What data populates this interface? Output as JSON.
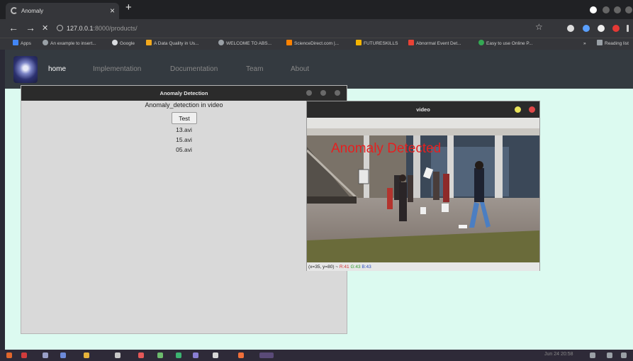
{
  "browser": {
    "tab_title": "Anomaly",
    "tab_close": "×",
    "new_tab": "+",
    "url_host": "127.0.0.1",
    "url_rest": ":8000/products/",
    "star": "☆",
    "back": "←",
    "forward": "→",
    "stop": "✕"
  },
  "bookmarks": [
    {
      "label": "Apps",
      "color": "#4285f4"
    },
    {
      "label": "An example to insert...",
      "color": "#9aa0a6"
    },
    {
      "label": "Google",
      "color": "#9aa0a6"
    },
    {
      "label": "A Data Quality in Us...",
      "color": "#f4a91c"
    },
    {
      "label": "WELCOME TO ABS...",
      "color": "#9aa0a6"
    },
    {
      "label": "ScienceDirect.com |...",
      "color": "#ff8200"
    },
    {
      "label": "FUTURESKILLS",
      "color": "#f5b400"
    },
    {
      "label": "Abnormal Event Det...",
      "color": "#e94235"
    },
    {
      "label": "Easy to use Online P...",
      "color": "#34a853"
    },
    {
      "label": "Reading list",
      "color": "#9aa0a6"
    }
  ],
  "site_nav": {
    "items": [
      "home",
      "Implementation",
      "Documentation",
      "Team",
      "About"
    ],
    "active": "home"
  },
  "anomaly_window": {
    "title": "Anomaly Detection",
    "heading": "Anomaly_detection in video",
    "button": "Test",
    "files": [
      "13.avi",
      "15.avi",
      "05.avi"
    ]
  },
  "video_window": {
    "title": "video",
    "overlay": "Anomaly Detected",
    "status_coords": "(x=35, y=80) ~",
    "status_r": "R:41",
    "status_g": "G:43",
    "status_b": "B:43"
  },
  "taskbar": {
    "clock": "Jun 24 20:58"
  },
  "colors": {
    "page_bg": "#dcfaf0",
    "navbar": "#343a40",
    "overlay_red": "#e52020"
  }
}
